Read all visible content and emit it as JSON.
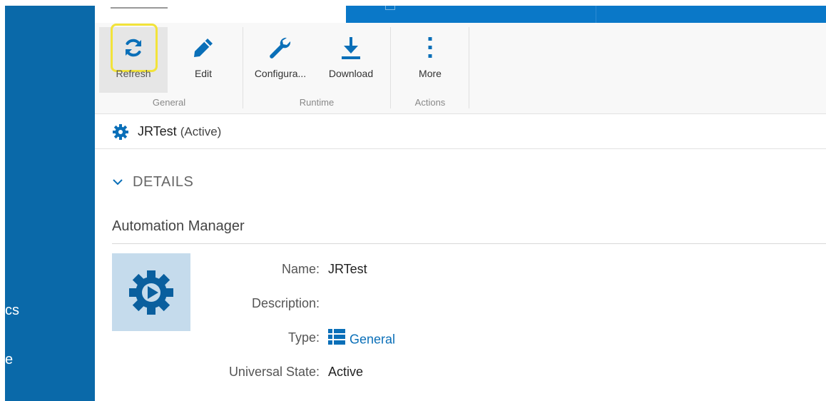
{
  "ribbon": {
    "buttons": {
      "refresh": "Refresh",
      "edit": "Edit",
      "configure": "Configura...",
      "download": "Download",
      "more": "More"
    },
    "groups": {
      "general": "General",
      "runtime": "Runtime",
      "actions": "Actions"
    }
  },
  "sidebar": {
    "partial_labels": [
      "cs",
      "e"
    ]
  },
  "titlebar": {
    "name": "JRTest",
    "state": "(Active)"
  },
  "details": {
    "header": "DETAILS",
    "section_title": "Automation Manager",
    "properties": {
      "name_label": "Name:",
      "name_value": "JRTest",
      "description_label": "Description:",
      "description_value": "",
      "type_label": "Type:",
      "type_value": "General",
      "state_label": "Universal State:",
      "state_value": "Active"
    }
  },
  "colors": {
    "sidebar": "#0a69a9",
    "header": "#0a78c8",
    "accent_icon": "#0a6fb8",
    "highlight": "#f2e33a",
    "thumb_bg": "#c5dbec"
  },
  "icons": {
    "refresh": "refresh-icon",
    "edit": "pencil-icon",
    "configure": "wrench-icon",
    "download": "download-icon",
    "more": "vertical-dots-icon",
    "title": "gear-icon",
    "details_toggle": "chevron-down-icon",
    "thumbnail": "gear-play-icon",
    "type": "list-icon"
  }
}
